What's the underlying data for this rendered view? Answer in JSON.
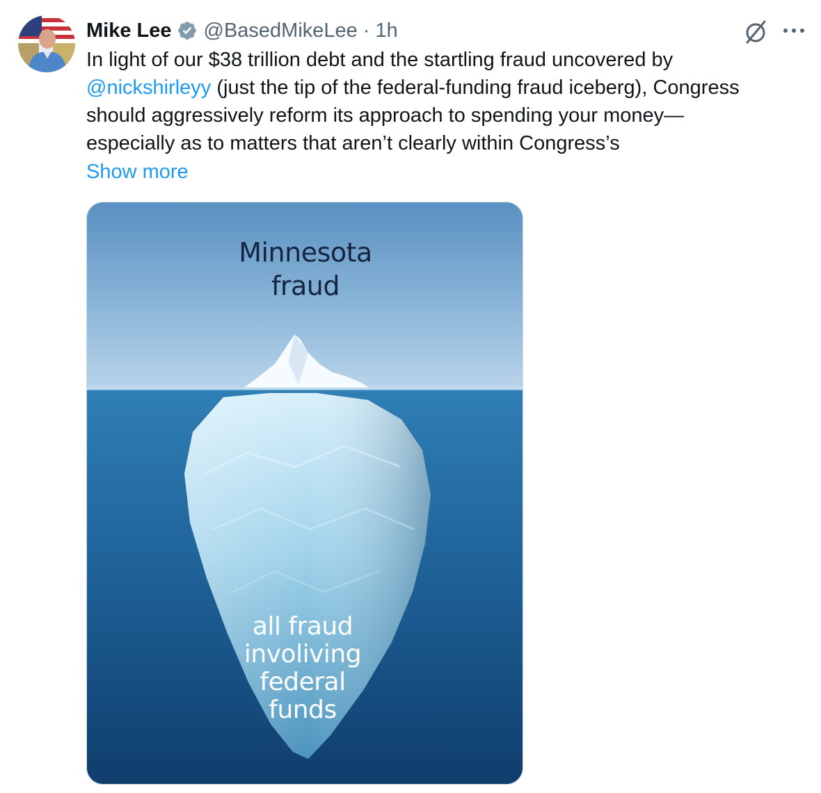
{
  "author": {
    "display_name": "Mike Lee",
    "handle": "@BasedMikeLee",
    "separator": "·",
    "time": "1h"
  },
  "icons": {
    "verified": "verified-badge-icon",
    "grok": "grok-icon",
    "more": "more-options-icon",
    "verified_color": "#829aab",
    "link_color": "#1d9bf0"
  },
  "tweet": {
    "line1": "In light of our $38 trillion debt and the startling fraud uncovered by",
    "mention": "@nickshirleyy",
    "line2_rest": " (just the tip of the federal-funding fraud iceberg), Congress",
    "line3": "should aggressively reform its approach to spending your money—",
    "line4": "especially as to matters that aren’t clearly within Congress’s",
    "show_more": "Show more"
  },
  "image": {
    "top_label": [
      "Minnesota",
      "fraud"
    ],
    "bottom_label": [
      "all fraud",
      "involiving",
      "federal",
      "funds"
    ]
  }
}
